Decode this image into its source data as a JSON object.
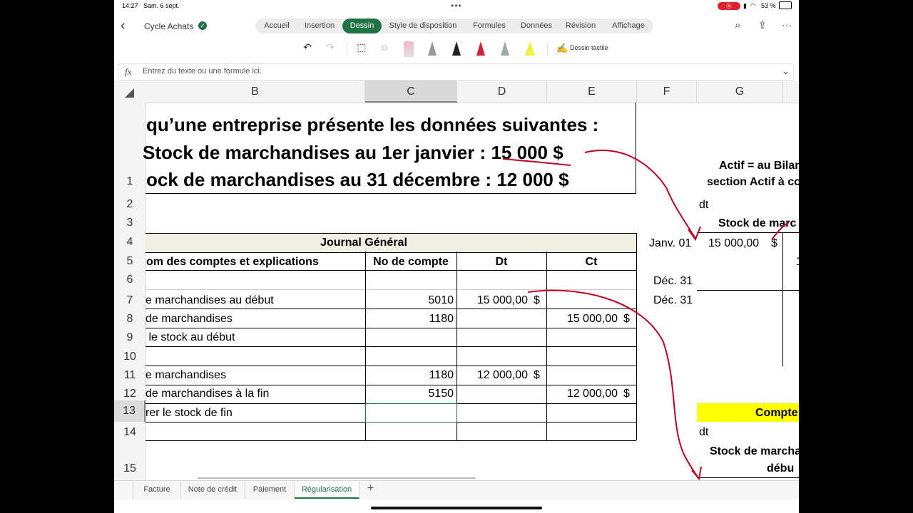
{
  "status": {
    "time": "14:27",
    "date": "Sam. 6 sept.",
    "battery": "53 %"
  },
  "title": {
    "filename": "Cycle Achats"
  },
  "ribbon_tabs": [
    "Accueil",
    "Insertion",
    "Dessin",
    "Style de disposition",
    "Formules",
    "Données",
    "Révision",
    "Affichage"
  ],
  "active_tab": "Dessin",
  "toolbar": {
    "touch_draw_label": "Dessin tactile"
  },
  "formula_bar": {
    "fx": "fx",
    "placeholder": "Entrez du texte ou une formule ici."
  },
  "columns": [
    "B",
    "C",
    "D",
    "E",
    "F",
    "G"
  ],
  "rows": [
    "1",
    "2",
    "3",
    "4",
    "5",
    "6",
    "7",
    "8",
    "9",
    "10",
    "11",
    "12",
    "13",
    "14",
    "15"
  ],
  "statement": {
    "line1": "qu’une entreprise présente les données suivantes :",
    "line2a": "Stock de marchandises au 1er janvier : ",
    "line2b": "15 000 $",
    "line3": "ock de marchandises au 31 décembre : 12 000 $"
  },
  "journal": {
    "title": "Journal Général",
    "headers": {
      "name": "om des comptes et explications",
      "account": "No de compte",
      "dt": "Dt",
      "ct": "Ct"
    },
    "entries": [
      {
        "name": "e marchandises au début",
        "account": "5010",
        "dt": "15 000,00",
        "dt_cur": "$",
        "ct": "",
        "ct_cur": ""
      },
      {
        "name": "de marchandises",
        "account": "1180",
        "dt": "",
        "dt_cur": "",
        "ct": "15 000,00",
        "ct_cur": "$"
      },
      {
        "name": " le stock au début",
        "account": "",
        "dt": "",
        "dt_cur": "",
        "ct": "",
        "ct_cur": ""
      },
      {
        "name": "",
        "account": "",
        "dt": "",
        "dt_cur": "",
        "ct": "",
        "ct_cur": ""
      },
      {
        "name": "e marchandises",
        "account": "1180",
        "dt": "12 000,00",
        "dt_cur": "$",
        "ct": "",
        "ct_cur": ""
      },
      {
        "name": "de marchandises à la fin",
        "account": "5150",
        "dt": "",
        "dt_cur": "",
        "ct": "12 000,00",
        "ct_cur": "$"
      },
      {
        "name": "rer le stock de fin",
        "account": "",
        "dt": "",
        "dt_cur": "",
        "ct": "",
        "ct_cur": ""
      }
    ]
  },
  "t_account": {
    "note1": "Actif = au Bilan",
    "note2": "section Actif à co",
    "dt": "dt",
    "title": "Stock de marc",
    "d1": "Janv. 01",
    "v1": "15 000,00",
    "v1_cur": "$",
    "d2": "Déc. 31",
    "d3": "Déc. 31",
    "clip": "1"
  },
  "t_account2": {
    "title": "Compte",
    "dt": "dt",
    "sub1": "Stock de marcha",
    "sub2": "débu"
  },
  "sheet_tabs": [
    "Facture",
    "Note de crédit",
    "Paiement",
    "Régularisation"
  ],
  "active_sheet": "Régularisation",
  "colors": {
    "accent": "#217346",
    "ink": "#c00020",
    "highlight_yellow": "#ffff00",
    "journal_header": "#efefe2"
  }
}
